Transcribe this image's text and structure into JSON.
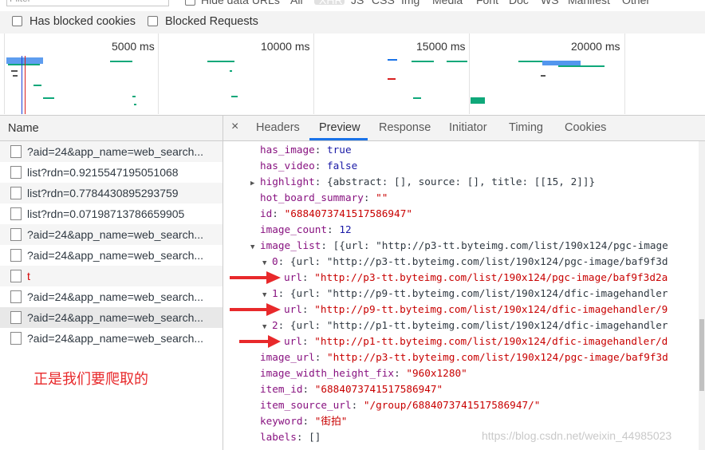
{
  "filter": {
    "placeholder": "Filter",
    "hide_data_urls": "Hide data URLs",
    "all": "All",
    "types": [
      "XHR",
      "JS",
      "CSS",
      "Img",
      "Media",
      "Font",
      "Doc",
      "WS",
      "Manifest",
      "Other"
    ]
  },
  "checkboxes": [
    {
      "label": "Has blocked cookies",
      "checked": false
    },
    {
      "label": "Blocked Requests",
      "checked": false
    }
  ],
  "overview": {
    "ticks": [
      "5000 ms",
      "10000 ms",
      "15000 ms",
      "20000 ms"
    ]
  },
  "name_column": {
    "header": "Name",
    "rows": [
      {
        "text": "?aid=24&app_name=web_search...",
        "selected": false,
        "red": false
      },
      {
        "text": "list?rdn=0.9215547195051068",
        "selected": false,
        "red": false
      },
      {
        "text": "list?rdn=0.7784430895293759",
        "selected": false,
        "red": false
      },
      {
        "text": "list?rdn=0.07198713786659905",
        "selected": false,
        "red": false
      },
      {
        "text": "?aid=24&app_name=web_search...",
        "selected": false,
        "red": false
      },
      {
        "text": "?aid=24&app_name=web_search...",
        "selected": false,
        "red": false
      },
      {
        "text": "t",
        "selected": false,
        "red": true
      },
      {
        "text": "?aid=24&app_name=web_search...",
        "selected": false,
        "red": false
      },
      {
        "text": "?aid=24&app_name=web_search...",
        "selected": true,
        "red": false
      },
      {
        "text": "?aid=24&app_name=web_search...",
        "selected": false,
        "red": false
      }
    ]
  },
  "annotation": "正是我们要爬取的",
  "tabs": {
    "close": "×",
    "items": [
      "Headers",
      "Preview",
      "Response",
      "Initiator",
      "Timing",
      "Cookies"
    ],
    "active": "Preview"
  },
  "preview_lines": [
    {
      "indent": 0,
      "toggle": "",
      "key": "has_image",
      "value": "true",
      "vtype": "n"
    },
    {
      "indent": 0,
      "toggle": "",
      "key": "has_video",
      "value": "false",
      "vtype": "n"
    },
    {
      "indent": 0,
      "toggle": "▶",
      "key": "highlight",
      "value": "{abstract: [], source: [], title: [[15, 2]]}",
      "vtype": "p"
    },
    {
      "indent": 0,
      "toggle": "",
      "key": "hot_board_summary",
      "value": "\"\"",
      "vtype": "s"
    },
    {
      "indent": 0,
      "toggle": "",
      "key": "id",
      "value": "\"6884073741517586947\"",
      "vtype": "s"
    },
    {
      "indent": 0,
      "toggle": "",
      "key": "image_count",
      "value": "12",
      "vtype": "n"
    },
    {
      "indent": 0,
      "toggle": "▼",
      "key": "image_list",
      "value": "[{url: \"http://p3-tt.byteimg.com/list/190x124/pgc-image",
      "vtype": "p"
    },
    {
      "indent": 1,
      "toggle": "▼",
      "key": "0",
      "value": "{url: \"http://p3-tt.byteimg.com/list/190x124/pgc-image/baf9f3d",
      "vtype": "p"
    },
    {
      "indent": 2,
      "toggle": "",
      "key": "url",
      "value": "\"http://p3-tt.byteimg.com/list/190x124/pgc-image/baf9f3d2a",
      "vtype": "s"
    },
    {
      "indent": 1,
      "toggle": "▼",
      "key": "1",
      "value": "{url: \"http://p9-tt.byteimg.com/list/190x124/dfic-imagehandler",
      "vtype": "p"
    },
    {
      "indent": 2,
      "toggle": "",
      "key": "url",
      "value": "\"http://p9-tt.byteimg.com/list/190x124/dfic-imagehandler/9",
      "vtype": "s"
    },
    {
      "indent": 1,
      "toggle": "▼",
      "key": "2",
      "value": "{url: \"http://p1-tt.byteimg.com/list/190x124/dfic-imagehandler",
      "vtype": "p"
    },
    {
      "indent": 2,
      "toggle": "",
      "key": "url",
      "value": "\"http://p1-tt.byteimg.com/list/190x124/dfic-imagehandler/d",
      "vtype": "s"
    },
    {
      "indent": 0,
      "toggle": "",
      "key": "image_url",
      "value": "\"http://p3-tt.byteimg.com/list/190x124/pgc-image/baf9f3d",
      "vtype": "s"
    },
    {
      "indent": 0,
      "toggle": "",
      "key": "image_width_height_fix",
      "value": "\"960x1280\"",
      "vtype": "s"
    },
    {
      "indent": 0,
      "toggle": "",
      "key": "item_id",
      "value": "\"6884073741517586947\"",
      "vtype": "s"
    },
    {
      "indent": 0,
      "toggle": "",
      "key": "item_source_url",
      "value": "\"/group/6884073741517586947/\"",
      "vtype": "s"
    },
    {
      "indent": 0,
      "toggle": "",
      "key": "keyword",
      "value": "\"街拍\"",
      "vtype": "s"
    },
    {
      "indent": 0,
      "toggle": "",
      "key": "labels",
      "value": "[]",
      "vtype": "p"
    }
  ],
  "watermark": "https://blog.csdn.net/weixin_44985023",
  "colors": {
    "accent": "#1a73e8",
    "annotation": "#e8292b",
    "string": "#c80000",
    "key": "#881280",
    "number": "#1a1aa6"
  }
}
